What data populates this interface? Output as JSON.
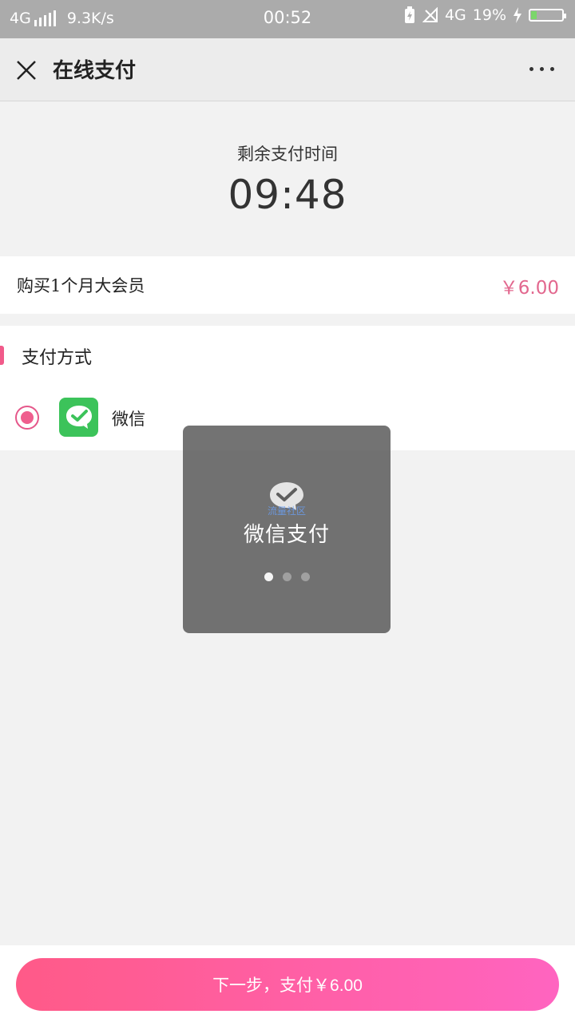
{
  "status_bar": {
    "network_left": "4G",
    "speed": "9.3K/s",
    "time": "00:52",
    "network_right": "4G",
    "battery_percent": "19%",
    "battery_level": 0.19
  },
  "nav": {
    "title": "在线支付"
  },
  "countdown": {
    "label": "剩余支付时间",
    "time": "09:48"
  },
  "product": {
    "name": "购买1个月大会员",
    "price": "￥6.00"
  },
  "payment": {
    "heading": "支付方式",
    "options": [
      {
        "label": "微信",
        "selected": true,
        "icon": "wechat-icon"
      }
    ]
  },
  "toast": {
    "title": "微信支付",
    "logo_text": "流量社区",
    "dots": 3,
    "active_dot": 0
  },
  "footer": {
    "button_label": "下一步，支付￥6.00"
  },
  "colors": {
    "accent": "#ef5e8e",
    "price": "#e2678e",
    "wechat_green": "#3cc35a"
  }
}
